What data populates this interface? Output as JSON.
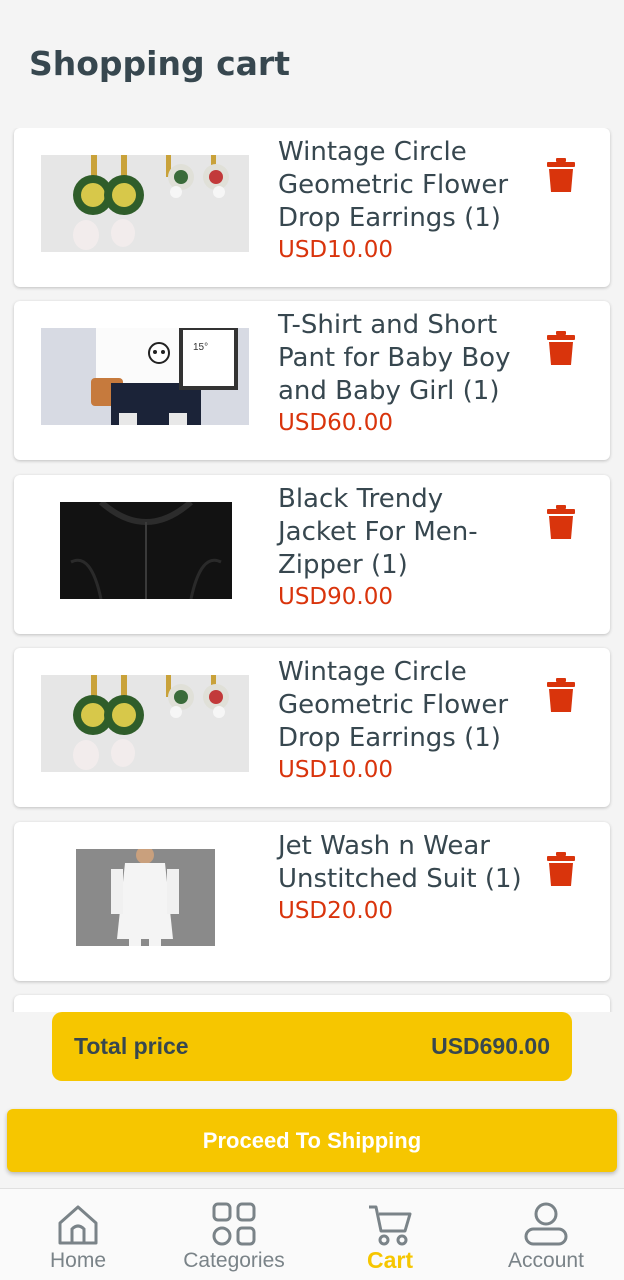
{
  "page": {
    "title": "Shopping cart"
  },
  "cart": {
    "items": [
      {
        "name": "Wintage Circle Geometric Flower Drop Earrings  (1)",
        "price": "USD10.00",
        "image": "earrings-photo"
      },
      {
        "name": "T-Shirt and Short Pant for Baby Boy and Baby Girl  (1)",
        "price": "USD60.00",
        "image": "baby-outfit-photo"
      },
      {
        "name": "Black Trendy Jacket For Men- Zipper   (1)",
        "price": "USD90.00",
        "image": "black-jacket-photo"
      },
      {
        "name": "Wintage Circle Geometric Flower Drop Earrings  (1)",
        "price": "USD10.00",
        "image": "earrings-photo"
      },
      {
        "name": "Jet Wash n Wear Unstitched Suit (1)",
        "price": "USD20.00",
        "image": "white-suit-photo"
      }
    ]
  },
  "total": {
    "label": "Total price",
    "value": "USD690.00"
  },
  "actions": {
    "proceed_label": "Proceed To Shipping"
  },
  "nav": {
    "home": "Home",
    "categories": "Categories",
    "cart": "Cart",
    "account": "Account"
  },
  "colors": {
    "accent": "#f6c600",
    "price": "#d9340c",
    "text": "#37474f",
    "trash": "#d9340c"
  }
}
